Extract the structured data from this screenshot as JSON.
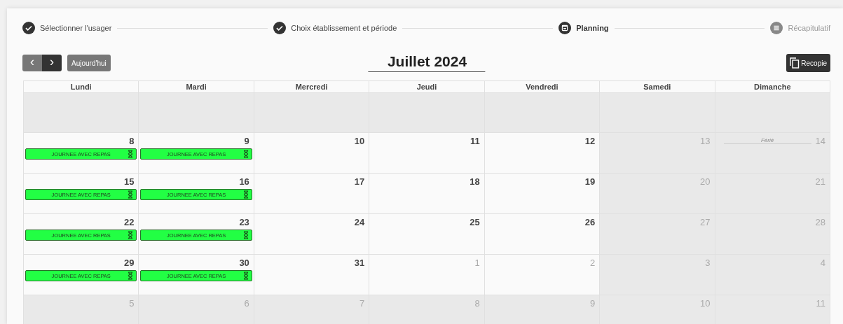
{
  "steps": [
    {
      "label": "Sélectionner l'usager",
      "done": true,
      "current": false
    },
    {
      "label": "Choix établissement et période",
      "done": true,
      "current": false
    },
    {
      "label": "Planning",
      "done": false,
      "current": true
    },
    {
      "label": "Récapitulatif",
      "done": false,
      "current": false
    }
  ],
  "toolbar": {
    "prev": "‹",
    "next": "›",
    "today": "Aujourd'hui",
    "title": "Juillet 2024",
    "copy": "Recopie"
  },
  "calendar": {
    "weekdays": [
      "Lundi",
      "Mardi",
      "Mercredi",
      "Jeudi",
      "Vendredi",
      "Samedi",
      "Dimanche"
    ],
    "weeks": [
      {
        "days": [
          {
            "shaded": true
          },
          {
            "shaded": true
          },
          {
            "shaded": true
          },
          {
            "shaded": true
          },
          {
            "shaded": true
          },
          {
            "shaded": true
          },
          {
            "shaded": true
          }
        ]
      },
      {
        "days": [
          {
            "number": "8",
            "events": [
              {
                "label": "JOURNEE AVEC REPAS",
                "kind": "pending"
              }
            ]
          },
          {
            "number": "9",
            "events": [
              {
                "label": "JOURNEE AVEC REPAS",
                "kind": "pending"
              }
            ]
          },
          {
            "number": "10"
          },
          {
            "number": "11"
          },
          {
            "number": "12"
          },
          {
            "number": "13",
            "muted": true,
            "shaded": true
          },
          {
            "number": "14",
            "muted": true,
            "shaded": true,
            "holiday": "Férié"
          }
        ]
      },
      {
        "days": [
          {
            "number": "15",
            "events": [
              {
                "label": "JOURNEE AVEC REPAS",
                "kind": "pending"
              }
            ]
          },
          {
            "number": "16",
            "events": [
              {
                "label": "JOURNEE AVEC REPAS",
                "kind": "pending"
              }
            ]
          },
          {
            "number": "17"
          },
          {
            "number": "18"
          },
          {
            "number": "19"
          },
          {
            "number": "20",
            "muted": true,
            "shaded": true
          },
          {
            "number": "21",
            "muted": true,
            "shaded": true
          }
        ]
      },
      {
        "days": [
          {
            "number": "22",
            "events": [
              {
                "label": "JOURNEE AVEC REPAS",
                "kind": "pending"
              }
            ]
          },
          {
            "number": "23",
            "events": [
              {
                "label": "JOURNEE AVEC REPAS",
                "kind": "pending"
              }
            ]
          },
          {
            "number": "24"
          },
          {
            "number": "25"
          },
          {
            "number": "26"
          },
          {
            "number": "27",
            "muted": true,
            "shaded": true
          },
          {
            "number": "28",
            "muted": true,
            "shaded": true
          }
        ]
      },
      {
        "days": [
          {
            "number": "29",
            "events": [
              {
                "label": "JOURNEE AVEC REPAS",
                "kind": "pending"
              }
            ]
          },
          {
            "number": "30",
            "events": [
              {
                "label": "JOURNEE AVEC REPAS",
                "kind": "pending"
              }
            ]
          },
          {
            "number": "31"
          },
          {
            "number": "1",
            "muted": true
          },
          {
            "number": "2",
            "muted": true
          },
          {
            "number": "3",
            "muted": true,
            "shaded": true
          },
          {
            "number": "4",
            "muted": true,
            "shaded": true
          }
        ]
      },
      {
        "days": [
          {
            "number": "5",
            "muted": true,
            "shaded": true
          },
          {
            "number": "6",
            "muted": true,
            "shaded": true
          },
          {
            "number": "7",
            "muted": true,
            "shaded": true
          },
          {
            "number": "8",
            "muted": true,
            "shaded": true
          },
          {
            "number": "9",
            "muted": true,
            "shaded": true
          },
          {
            "number": "10",
            "muted": true,
            "shaded": true
          },
          {
            "number": "11",
            "muted": true,
            "shaded": true
          }
        ]
      }
    ]
  }
}
